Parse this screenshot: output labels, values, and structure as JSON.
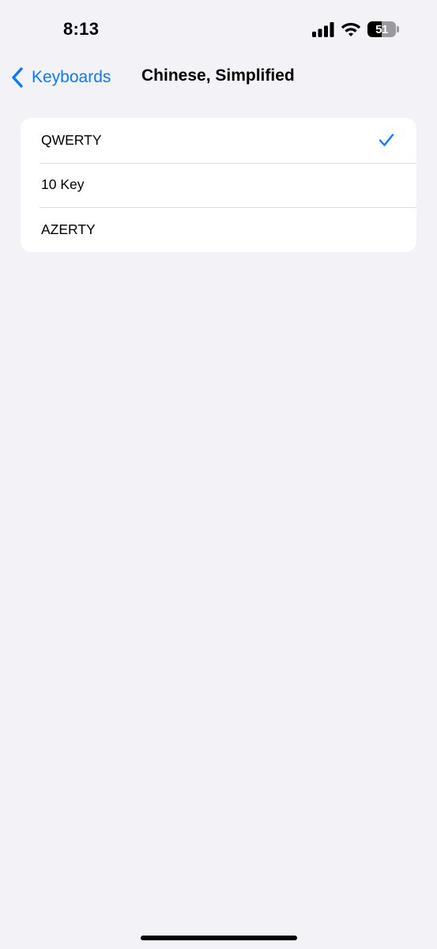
{
  "status_bar": {
    "time": "8:13",
    "battery_level": "51",
    "battery_fraction": 0.51,
    "icons": [
      "cellular-signal-icon",
      "wifi-icon",
      "battery-icon"
    ]
  },
  "nav": {
    "back_label": "Keyboards",
    "title": "Chinese, Simplified",
    "accent_color": "#0A7AFF"
  },
  "options": [
    {
      "label": "QWERTY",
      "selected": true
    },
    {
      "label": "10 Key",
      "selected": false
    },
    {
      "label": "AZERTY",
      "selected": false
    }
  ],
  "colors": {
    "background": "#F2F2F7",
    "card": "#FFFFFF",
    "checkmark": "#0A7AFF"
  }
}
